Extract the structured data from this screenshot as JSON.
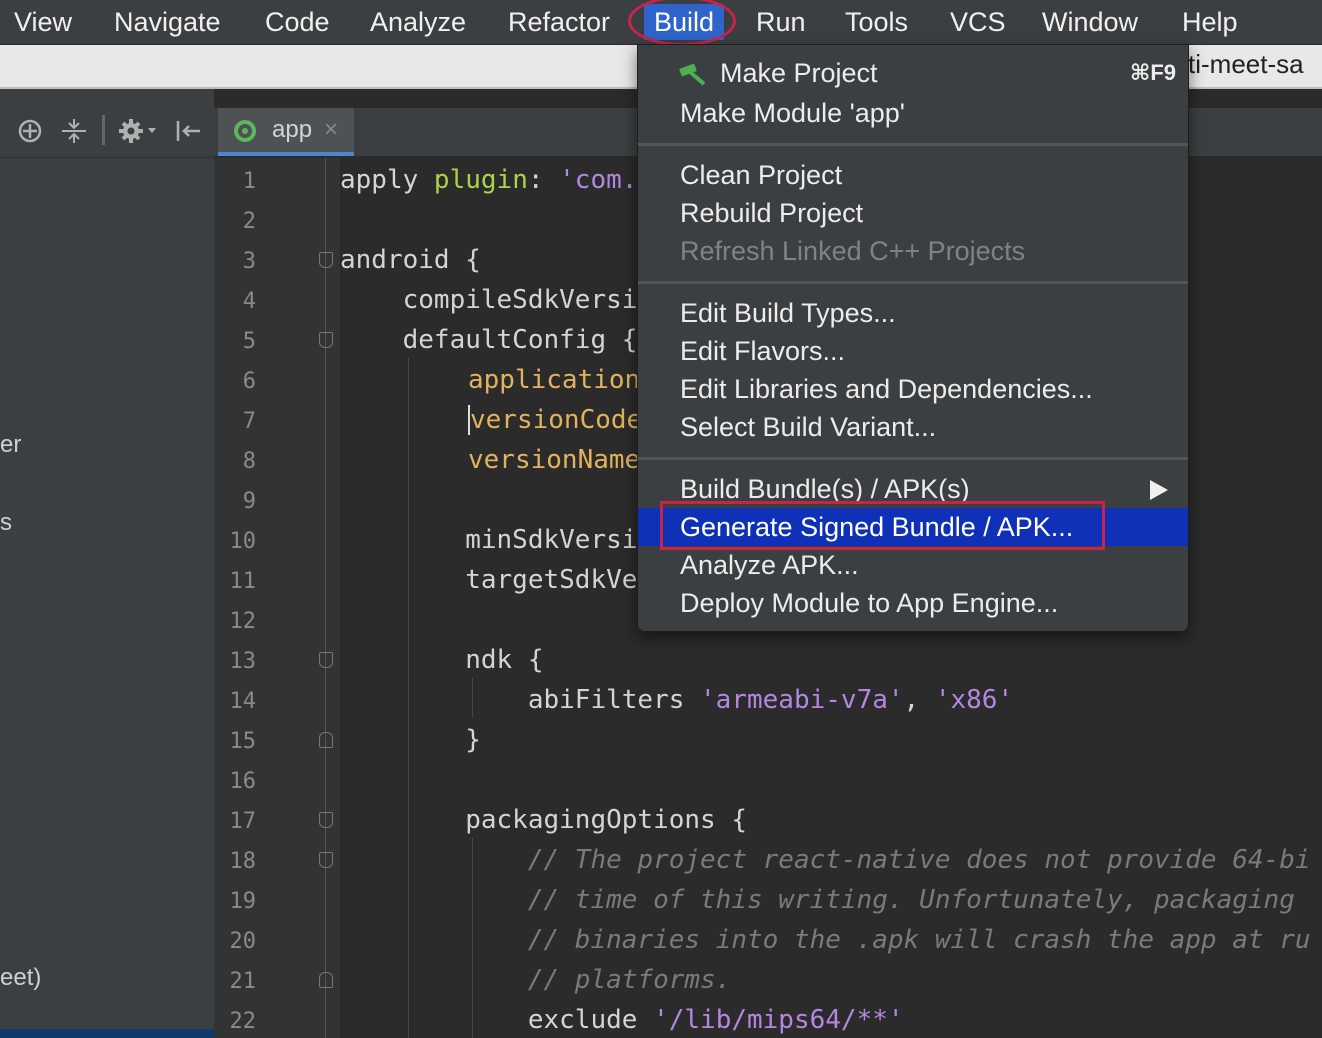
{
  "menubar": {
    "items": [
      {
        "label": "View",
        "active": false
      },
      {
        "label": "Navigate",
        "active": false
      },
      {
        "label": "Code",
        "active": false
      },
      {
        "label": "Analyze",
        "active": false
      },
      {
        "label": "Refactor",
        "active": false
      },
      {
        "label": "Build",
        "active": true
      },
      {
        "label": "Run",
        "active": false
      },
      {
        "label": "Tools",
        "active": false
      },
      {
        "label": "VCS",
        "active": false
      },
      {
        "label": "Window",
        "active": false
      },
      {
        "label": "Help",
        "active": false
      }
    ]
  },
  "window_title_fragment": "ti-meet-sa",
  "left_panel": {
    "fragments": [
      "er",
      "s",
      "eet)"
    ]
  },
  "editor_tab": {
    "label": "app",
    "close": "×"
  },
  "line_numbers": [
    "1",
    "2",
    "3",
    "4",
    "5",
    "6",
    "7",
    "8",
    "9",
    "10",
    "11",
    "12",
    "13",
    "14",
    "15",
    "16",
    "17",
    "18",
    "19",
    "20",
    "21",
    "22"
  ],
  "code": {
    "l1_a": "apply ",
    "l1_b": "plugin",
    "l1_c": ": ",
    "l1_d": "'com.",
    "l3": "android {",
    "l4": "    compileSdkVersi",
    "l5": "    defaultConfig {",
    "l6": "application",
    "l7": "versionCode",
    "l8": "versionName",
    "l10": "        minSdkVersi",
    "l11": "        targetSdkVe",
    "l13": "        ndk {",
    "l14_a": "            abiFilters ",
    "l14_b": "'armeabi-v7a'",
    "l14_c": ", ",
    "l14_d": "'x86'",
    "l15": "        }",
    "l17": "        packagingOptions {",
    "l18": "            // The project react-native does not provide 64-bi",
    "l19": "            // time of this writing. Unfortunately, packaging",
    "l20": "            // binaries into the .apk will crash the app at ru",
    "l21": "            // platforms.",
    "l22_a": "            exclude ",
    "l22_b": "'/lib/mips64/**'"
  },
  "build_menu": {
    "make_project": {
      "label": "Make Project",
      "shortcut": "⌘F9"
    },
    "make_module": "Make Module 'app'",
    "clean_project": "Clean Project",
    "rebuild_project": "Rebuild Project",
    "refresh_cpp": "Refresh Linked C++ Projects",
    "edit_build_types": "Edit Build Types...",
    "edit_flavors": "Edit Flavors...",
    "edit_libraries": "Edit Libraries and Dependencies...",
    "select_variant": "Select Build Variant...",
    "build_bundles": "Build Bundle(s) / APK(s)",
    "generate_signed": "Generate Signed Bundle / APK...",
    "analyze_apk": "Analyze APK...",
    "deploy_module": "Deploy Module to App Engine..."
  },
  "colors": {
    "highlight": "#0f31b8",
    "annotation": "#c8234d",
    "menu_active": "#2f65ca"
  }
}
